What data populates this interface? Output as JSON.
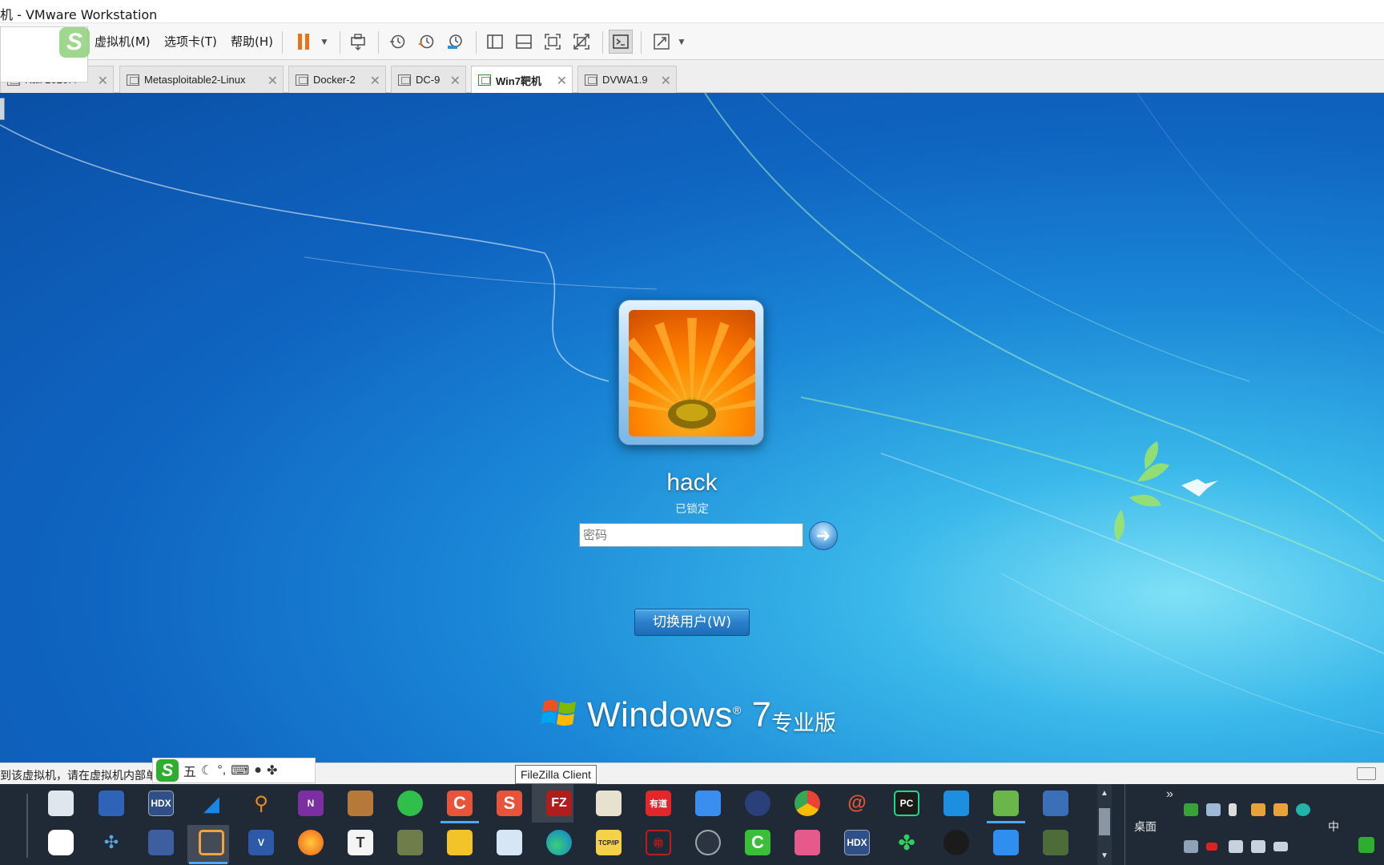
{
  "window": {
    "title": "机 - VMware Workstation"
  },
  "menu": {
    "vm": "虚拟机(M)",
    "tabs": "选项卡(T)",
    "help": "帮助(H)"
  },
  "tabs": [
    {
      "label": "Kali 2020.4",
      "active": false
    },
    {
      "label": "Metasploitable2-Linux",
      "active": false
    },
    {
      "label": "Docker-2",
      "active": false
    },
    {
      "label": "DC-9",
      "active": false
    },
    {
      "label": "Win7靶机",
      "active": true
    },
    {
      "label": "DVWA1.9",
      "active": false
    }
  ],
  "login": {
    "username": "hack",
    "status": "已锁定",
    "password_placeholder": "密码",
    "switch_user": "切换用户(W)",
    "brand": "Windows",
    "version": "7",
    "edition": "专业版"
  },
  "statusbar": {
    "message": "到该虚拟机，请在虚拟机内部单",
    "tooltip": "FileZilla Client"
  },
  "ime": {
    "mode": "五",
    "moon": "☾",
    "punct": "°,",
    "keyboard": "⌨"
  },
  "taskbar": {
    "row1": [
      "file-explorer-icon",
      "save-icon",
      "hdx-icon",
      "wireshark-icon",
      "search-tool-icon",
      "onenote-icon",
      "library-icon",
      "wechat-icon",
      "pdf-c-icon",
      "wps-s-icon",
      "filezilla-icon",
      "python-icon",
      "youdao-icon",
      "feishu-icon",
      "eclipse-icon",
      "chrome-icon",
      "burp-icon",
      "pycharm-icon",
      "remote-icon",
      "notepad-icon",
      "network-icon"
    ],
    "row2": [
      "baidu-netdisk-icon",
      "molecule-icon",
      "hdx-view-icon",
      "vmware-icon",
      "visio-icon",
      "firefox-icon",
      "typora-icon",
      "app-icon",
      "sticky-notes-icon",
      "magnifier-icon",
      "edge-icon",
      "tcp-ip-icon",
      "seal-icon",
      "vpn-lock-icon",
      "camtasia-icon",
      "snipaste-icon",
      "hdx-icon-2",
      "clover-icon",
      "qq-icon",
      "feishu-bird-icon",
      "sec-tool-icon"
    ],
    "desktop_label": "桌面",
    "ime_lang": "中",
    "youdao_label": "有道",
    "hdx_label": "HDX",
    "pc_label": "PC",
    "tcpip_label": "TCP/IP",
    "chevron": "»"
  },
  "colors": {
    "accent": "#4fa8ff",
    "vm_bg": "#0f65c1",
    "pause": "#e8731c"
  }
}
